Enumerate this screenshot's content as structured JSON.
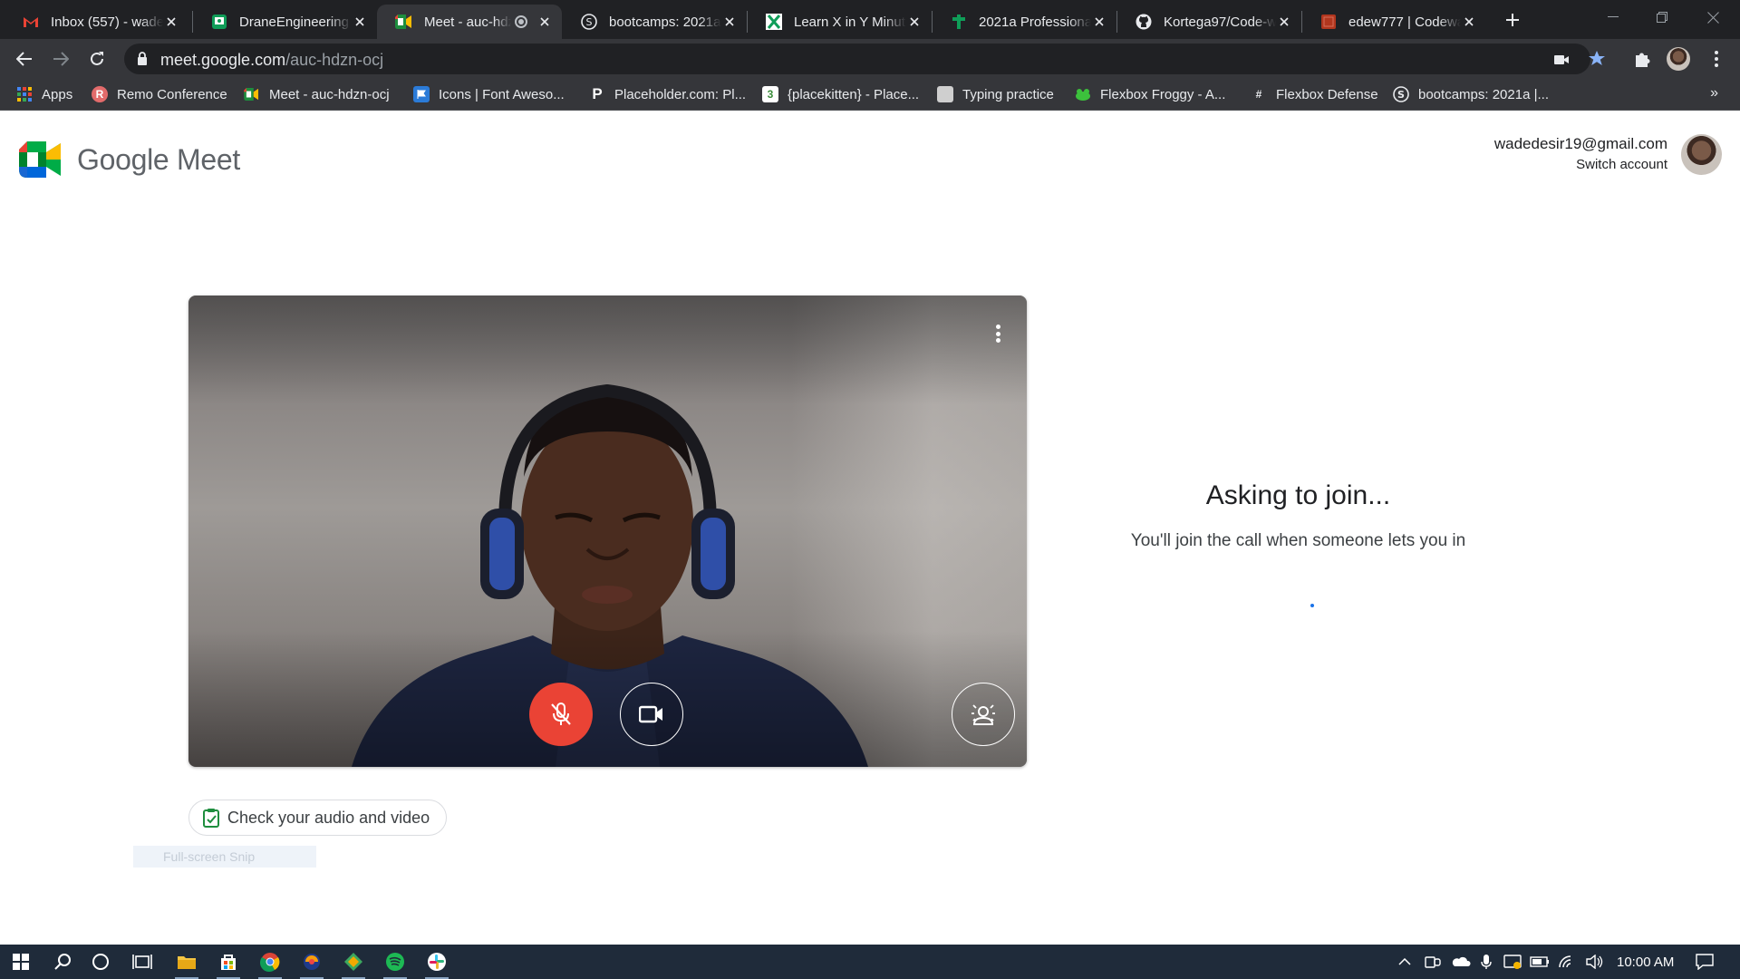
{
  "browser": {
    "tabs": [
      {
        "title": "Inbox (557) - wade",
        "icon": "gmail-icon",
        "active": false
      },
      {
        "title": "DraneEngineering",
        "icon": "classroom-icon",
        "active": false
      },
      {
        "title": "Meet - auc-hdz",
        "icon": "meet-icon",
        "active": true
      },
      {
        "title": "bootcamps: 2021a",
        "icon": "s-circle-icon",
        "active": false
      },
      {
        "title": "Learn X in Y Minut",
        "icon": "x-icon",
        "active": false
      },
      {
        "title": "2021a Professional",
        "icon": "cross-icon",
        "active": false
      },
      {
        "title": "Kortega97/Code-w",
        "icon": "github-icon",
        "active": false
      },
      {
        "title": "edew777 | Codewa",
        "icon": "codewars-icon",
        "active": false
      }
    ],
    "url_host": "meet.google.com",
    "url_path": "/auc-hdzn-ocj",
    "bookmarks": [
      {
        "label": "Apps",
        "icon": "apps-grid-icon"
      },
      {
        "label": "Remo Conference",
        "icon": "remo-icon"
      },
      {
        "label": "Meet - auc-hdzn-ocj",
        "icon": "meet-icon"
      },
      {
        "label": "Icons | Font Aweso...",
        "icon": "flag-icon"
      },
      {
        "label": "Placeholder.com: Pl...",
        "icon": "p-icon"
      },
      {
        "label": "{placekitten} - Place...",
        "icon": "kitten-icon"
      },
      {
        "label": "Typing practice",
        "icon": "typing-icon"
      },
      {
        "label": "Flexbox Froggy - A...",
        "icon": "frog-icon"
      },
      {
        "label": "Flexbox Defense",
        "icon": "defense-icon"
      },
      {
        "label": "bootcamps: 2021a |...",
        "icon": "s-circle-icon"
      }
    ]
  },
  "meet": {
    "logo_text": "Google Meet",
    "account_email": "wadedesir19@gmail.com",
    "switch_account": "Switch account",
    "check_av_label": "Check your audio and video",
    "snip_label": "Full-screen Snip",
    "join_title": "Asking to join...",
    "join_subtitle": "You'll join the call when someone lets you in",
    "mic_state": "muted",
    "camera_state": "on"
  },
  "taskbar": {
    "clock": "10:00 AM"
  },
  "colors": {
    "accent_red": "#ea4335",
    "meet_green": "#00832d",
    "chrome_dark": "#202124",
    "taskbar": "#1f2b3a"
  }
}
